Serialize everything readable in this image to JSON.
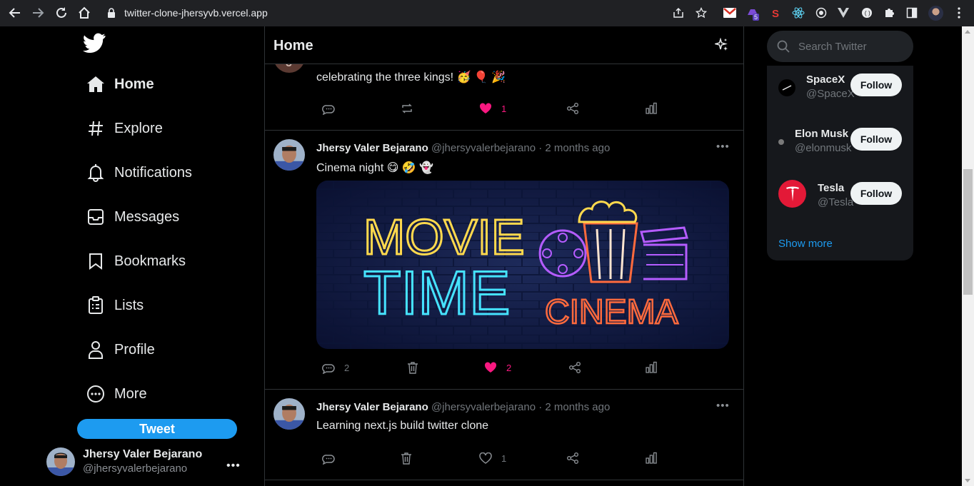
{
  "browser": {
    "url": "twitter-clone-jhersyvb.vercel.app",
    "extension_badge": "5"
  },
  "sidebar": {
    "items": [
      {
        "label": "Home",
        "icon": "home-icon",
        "active": true
      },
      {
        "label": "Explore",
        "icon": "hashtag-icon"
      },
      {
        "label": "Notifications",
        "icon": "bell-icon"
      },
      {
        "label": "Messages",
        "icon": "inbox-icon"
      },
      {
        "label": "Bookmarks",
        "icon": "bookmark-icon"
      },
      {
        "label": "Lists",
        "icon": "clipboard-icon"
      },
      {
        "label": "Profile",
        "icon": "user-icon"
      },
      {
        "label": "More",
        "icon": "more-circle-icon"
      }
    ],
    "tweet_label": "Tweet",
    "account": {
      "name": "Jhersy Valer Bejarano",
      "handle": "@jhersyvalerbejarano",
      "more": "•••"
    }
  },
  "feed": {
    "title": "Home",
    "posts": [
      {
        "text": "celebrating the three kings! 🥳 🎈 🎉",
        "avatar_letter": "J",
        "likes": "1",
        "liked": true
      },
      {
        "name": "Jhersy Valer Bejarano",
        "handle": "@jhersyvalerbejarano",
        "time": "· 2 months ago",
        "text": "Cinema night 😋 🤣 👻",
        "comments": "2",
        "likes": "2",
        "liked": true,
        "media": {
          "line1": "MOVIE",
          "line2": "TIME",
          "line3": "CINEMA"
        },
        "more": "•••"
      },
      {
        "name": "Jhersy Valer Bejarano",
        "handle": "@jhersyvalerbejarano",
        "time": "· 2 months ago",
        "text": "Learning next.js build twitter clone",
        "likes": "1",
        "liked": false,
        "more": "•••"
      }
    ]
  },
  "right": {
    "search_placeholder": "Search Twitter",
    "who_to_follow": [
      {
        "name": "SpaceX",
        "handle": "@SpaceX",
        "follow_label": "Follow"
      },
      {
        "name": "Elon Musk",
        "handle": "@elonmusk",
        "follow_label": "Follow"
      },
      {
        "name": "Tesla",
        "handle": "@Tesla",
        "follow_label": "Follow"
      }
    ],
    "show_more": "Show more"
  },
  "colors": {
    "accent": "#1d9bf0",
    "like": "#f91880",
    "background": "#000000",
    "card": "#16181c"
  }
}
